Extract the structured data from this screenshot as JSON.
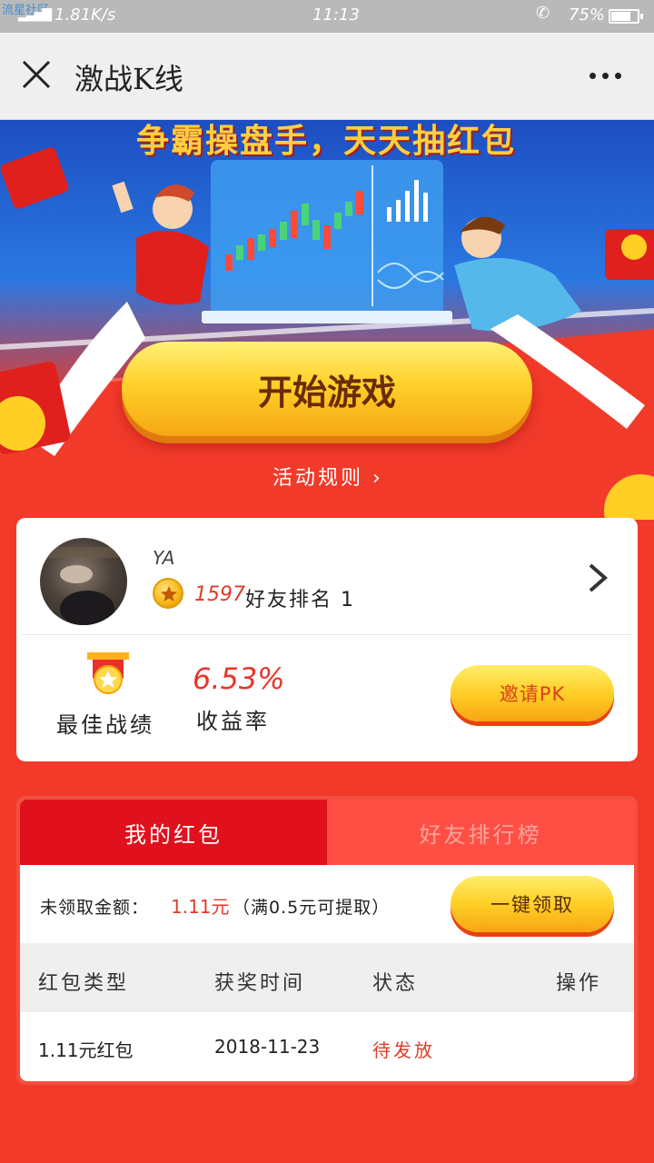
{
  "status_bar": {
    "watermark": "流星社区",
    "network": "4G",
    "speed": "1.81K/s",
    "time": "11:13",
    "hd": "HD",
    "battery": "75%",
    "battery_level": 0.75
  },
  "nav": {
    "title": "激战K线"
  },
  "hero": {
    "slogan": "争霸操盘手，天天抽红包",
    "start_button": "开始游戏",
    "rules_link": "活动规则"
  },
  "profile": {
    "username": "YA",
    "coins": "1597",
    "friend_rank": "好友排名 1",
    "best_record_label": "最佳战绩",
    "return_rate": "6.53%",
    "return_rate_label": "收益率",
    "invite_button": "邀请PK"
  },
  "packets": {
    "tabs": [
      {
        "label": "我的红包",
        "active": true
      },
      {
        "label": "好友排行榜",
        "active": false
      }
    ],
    "unclaimed_label": "未领取金额：",
    "unclaimed_amount": "1.11元",
    "unclaimed_note": "（满0.5元可提取）",
    "claim_button": "一键领取",
    "columns": [
      "红包类型",
      "获奖时间",
      "状态",
      "操作"
    ],
    "rows": [
      {
        "type": "1.11元红包",
        "time": "2018-11-23",
        "status": "待发放",
        "action": ""
      }
    ]
  },
  "colors": {
    "accent_red": "#e23a2a",
    "tab_active": "#e0101c",
    "button_yellow": "#ffcf26"
  }
}
